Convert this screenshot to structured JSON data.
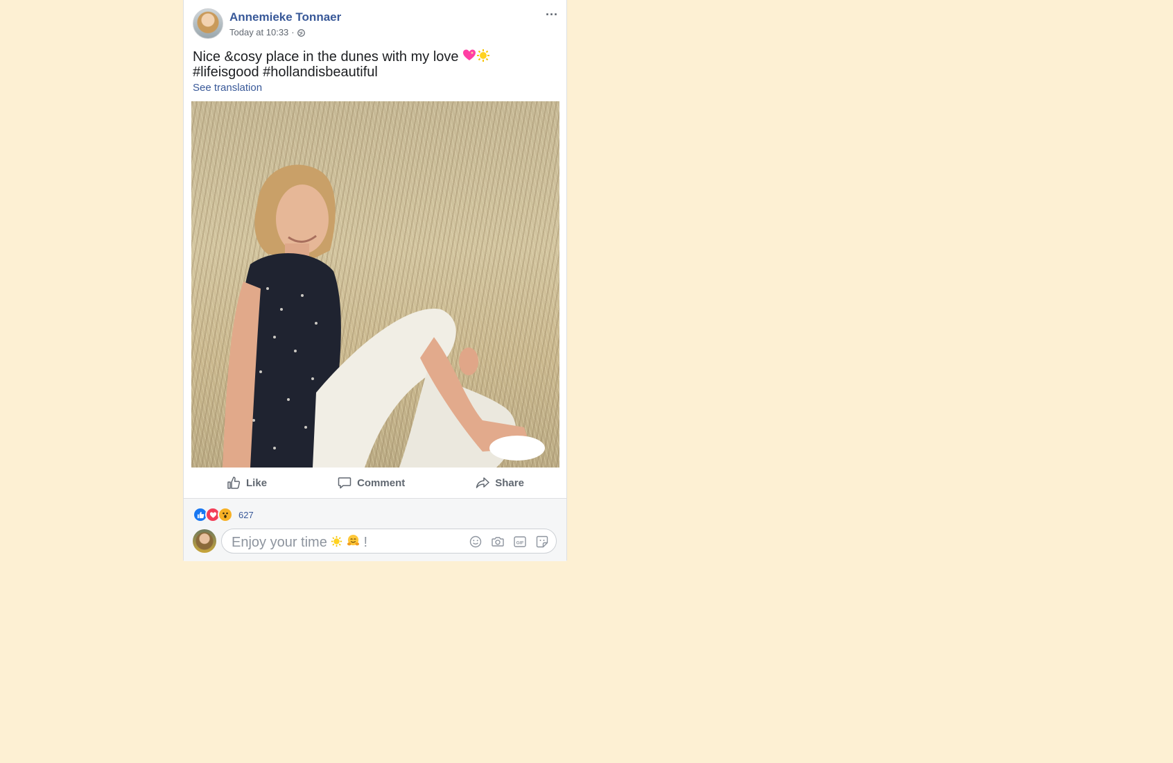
{
  "post": {
    "author": "Annemieke Tonnaer",
    "timestamp": "Today at 10:33",
    "separator": "·",
    "privacy_icon": "globe-icon",
    "more_label": "···",
    "text_line1": "Nice &cosy place in the dunes with my love",
    "text_line2": "#lifeisgood #hollandisbeautiful",
    "see_translation": "See translation",
    "photo_alt": "photo"
  },
  "actions": {
    "like": "Like",
    "comment": "Comment",
    "share": "Share"
  },
  "reactions": {
    "types": [
      "like-icon",
      "love-icon",
      "wow-icon"
    ],
    "count": "627"
  },
  "comment_input": {
    "value": "Enjoy your time",
    "value_suffix": "!",
    "tools": [
      "emoji-icon",
      "camera-icon",
      "gif-icon",
      "sticker-icon"
    ]
  },
  "colors": {
    "page_bg": "#fdf0d3",
    "link": "#385898",
    "like_blue": "#1877f2",
    "love_red": "#f33e58",
    "wow_yellow": "#f7b125"
  }
}
